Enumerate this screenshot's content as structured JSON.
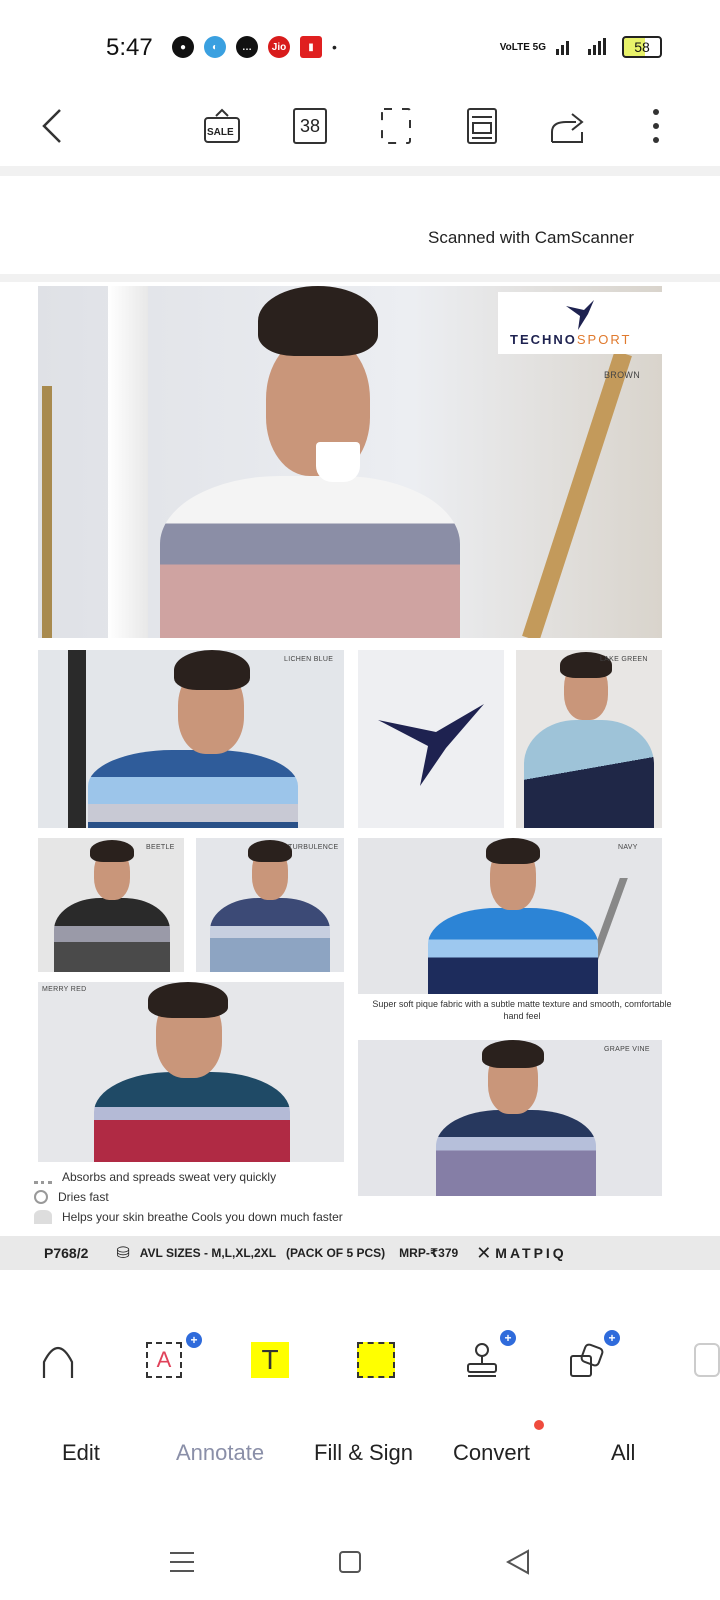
{
  "status_bar": {
    "time": "5:47",
    "network_label": "VoLTE 5G",
    "battery": "58"
  },
  "toolbar": {
    "sale_label": "SALE",
    "page_count": "38"
  },
  "document": {
    "scanned_with": "Scanned with CamScanner",
    "brand_name_a": "TECHNO",
    "brand_name_b": "SPORT",
    "color_tags": {
      "brown": "BROWN",
      "lichen_blue": "LICHEN BLUE",
      "lake_green": "LAKE GREEN",
      "beetle": "BEETLE",
      "turbulence": "TURBULENCE",
      "navy": "NAVY",
      "merry_red": "MERRY RED",
      "grape_vine": "GRAPE VINE"
    },
    "feature_text": "Super soft pique fabric with a subtle matte texture and smooth, comfortable hand feel",
    "bullets": [
      "Absorbs and spreads sweat very quickly",
      "Dries fast",
      "Helps your skin breathe Cools you down much faster"
    ],
    "footer": {
      "code": "P768/2",
      "sizes": "AVL SIZES - M,L,XL,2XL",
      "pack": "(PACK OF 5 PCS)",
      "mrp": "MRP-₹379",
      "brand": "MATPIQ"
    }
  },
  "bottom_tabs": {
    "edit": "Edit",
    "annotate": "Annotate",
    "fill_sign": "Fill & Sign",
    "convert": "Convert",
    "all": "All"
  },
  "colors": {
    "accent_blue": "#2f6bdb",
    "highlight_yellow": "#ffff00",
    "notify_red": "#ef4b3d",
    "active_tab": "#8a8fa8"
  }
}
